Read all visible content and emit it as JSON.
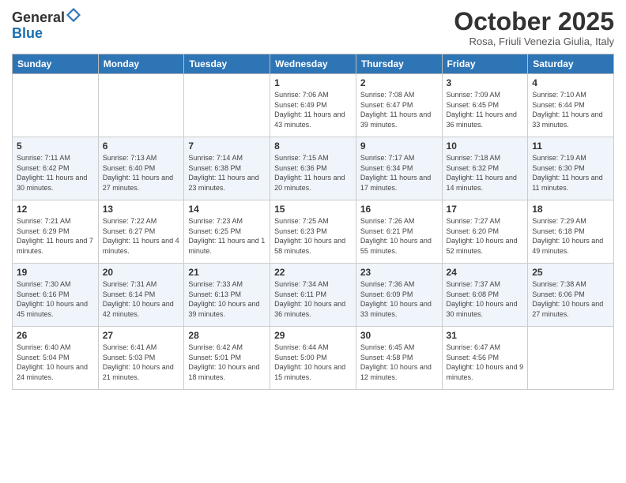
{
  "header": {
    "logo_general": "General",
    "logo_blue": "Blue",
    "month_title": "October 2025",
    "location": "Rosa, Friuli Venezia Giulia, Italy"
  },
  "weekdays": [
    "Sunday",
    "Monday",
    "Tuesday",
    "Wednesday",
    "Thursday",
    "Friday",
    "Saturday"
  ],
  "weeks": [
    [
      {
        "day": "",
        "sunrise": "",
        "sunset": "",
        "daylight": ""
      },
      {
        "day": "",
        "sunrise": "",
        "sunset": "",
        "daylight": ""
      },
      {
        "day": "",
        "sunrise": "",
        "sunset": "",
        "daylight": ""
      },
      {
        "day": "1",
        "sunrise": "Sunrise: 7:06 AM",
        "sunset": "Sunset: 6:49 PM",
        "daylight": "Daylight: 11 hours and 43 minutes."
      },
      {
        "day": "2",
        "sunrise": "Sunrise: 7:08 AM",
        "sunset": "Sunset: 6:47 PM",
        "daylight": "Daylight: 11 hours and 39 minutes."
      },
      {
        "day": "3",
        "sunrise": "Sunrise: 7:09 AM",
        "sunset": "Sunset: 6:45 PM",
        "daylight": "Daylight: 11 hours and 36 minutes."
      },
      {
        "day": "4",
        "sunrise": "Sunrise: 7:10 AM",
        "sunset": "Sunset: 6:44 PM",
        "daylight": "Daylight: 11 hours and 33 minutes."
      }
    ],
    [
      {
        "day": "5",
        "sunrise": "Sunrise: 7:11 AM",
        "sunset": "Sunset: 6:42 PM",
        "daylight": "Daylight: 11 hours and 30 minutes."
      },
      {
        "day": "6",
        "sunrise": "Sunrise: 7:13 AM",
        "sunset": "Sunset: 6:40 PM",
        "daylight": "Daylight: 11 hours and 27 minutes."
      },
      {
        "day": "7",
        "sunrise": "Sunrise: 7:14 AM",
        "sunset": "Sunset: 6:38 PM",
        "daylight": "Daylight: 11 hours and 23 minutes."
      },
      {
        "day": "8",
        "sunrise": "Sunrise: 7:15 AM",
        "sunset": "Sunset: 6:36 PM",
        "daylight": "Daylight: 11 hours and 20 minutes."
      },
      {
        "day": "9",
        "sunrise": "Sunrise: 7:17 AM",
        "sunset": "Sunset: 6:34 PM",
        "daylight": "Daylight: 11 hours and 17 minutes."
      },
      {
        "day": "10",
        "sunrise": "Sunrise: 7:18 AM",
        "sunset": "Sunset: 6:32 PM",
        "daylight": "Daylight: 11 hours and 14 minutes."
      },
      {
        "day": "11",
        "sunrise": "Sunrise: 7:19 AM",
        "sunset": "Sunset: 6:30 PM",
        "daylight": "Daylight: 11 hours and 11 minutes."
      }
    ],
    [
      {
        "day": "12",
        "sunrise": "Sunrise: 7:21 AM",
        "sunset": "Sunset: 6:29 PM",
        "daylight": "Daylight: 11 hours and 7 minutes."
      },
      {
        "day": "13",
        "sunrise": "Sunrise: 7:22 AM",
        "sunset": "Sunset: 6:27 PM",
        "daylight": "Daylight: 11 hours and 4 minutes."
      },
      {
        "day": "14",
        "sunrise": "Sunrise: 7:23 AM",
        "sunset": "Sunset: 6:25 PM",
        "daylight": "Daylight: 11 hours and 1 minute."
      },
      {
        "day": "15",
        "sunrise": "Sunrise: 7:25 AM",
        "sunset": "Sunset: 6:23 PM",
        "daylight": "Daylight: 10 hours and 58 minutes."
      },
      {
        "day": "16",
        "sunrise": "Sunrise: 7:26 AM",
        "sunset": "Sunset: 6:21 PM",
        "daylight": "Daylight: 10 hours and 55 minutes."
      },
      {
        "day": "17",
        "sunrise": "Sunrise: 7:27 AM",
        "sunset": "Sunset: 6:20 PM",
        "daylight": "Daylight: 10 hours and 52 minutes."
      },
      {
        "day": "18",
        "sunrise": "Sunrise: 7:29 AM",
        "sunset": "Sunset: 6:18 PM",
        "daylight": "Daylight: 10 hours and 49 minutes."
      }
    ],
    [
      {
        "day": "19",
        "sunrise": "Sunrise: 7:30 AM",
        "sunset": "Sunset: 6:16 PM",
        "daylight": "Daylight: 10 hours and 45 minutes."
      },
      {
        "day": "20",
        "sunrise": "Sunrise: 7:31 AM",
        "sunset": "Sunset: 6:14 PM",
        "daylight": "Daylight: 10 hours and 42 minutes."
      },
      {
        "day": "21",
        "sunrise": "Sunrise: 7:33 AM",
        "sunset": "Sunset: 6:13 PM",
        "daylight": "Daylight: 10 hours and 39 minutes."
      },
      {
        "day": "22",
        "sunrise": "Sunrise: 7:34 AM",
        "sunset": "Sunset: 6:11 PM",
        "daylight": "Daylight: 10 hours and 36 minutes."
      },
      {
        "day": "23",
        "sunrise": "Sunrise: 7:36 AM",
        "sunset": "Sunset: 6:09 PM",
        "daylight": "Daylight: 10 hours and 33 minutes."
      },
      {
        "day": "24",
        "sunrise": "Sunrise: 7:37 AM",
        "sunset": "Sunset: 6:08 PM",
        "daylight": "Daylight: 10 hours and 30 minutes."
      },
      {
        "day": "25",
        "sunrise": "Sunrise: 7:38 AM",
        "sunset": "Sunset: 6:06 PM",
        "daylight": "Daylight: 10 hours and 27 minutes."
      }
    ],
    [
      {
        "day": "26",
        "sunrise": "Sunrise: 6:40 AM",
        "sunset": "Sunset: 5:04 PM",
        "daylight": "Daylight: 10 hours and 24 minutes."
      },
      {
        "day": "27",
        "sunrise": "Sunrise: 6:41 AM",
        "sunset": "Sunset: 5:03 PM",
        "daylight": "Daylight: 10 hours and 21 minutes."
      },
      {
        "day": "28",
        "sunrise": "Sunrise: 6:42 AM",
        "sunset": "Sunset: 5:01 PM",
        "daylight": "Daylight: 10 hours and 18 minutes."
      },
      {
        "day": "29",
        "sunrise": "Sunrise: 6:44 AM",
        "sunset": "Sunset: 5:00 PM",
        "daylight": "Daylight: 10 hours and 15 minutes."
      },
      {
        "day": "30",
        "sunrise": "Sunrise: 6:45 AM",
        "sunset": "Sunset: 4:58 PM",
        "daylight": "Daylight: 10 hours and 12 minutes."
      },
      {
        "day": "31",
        "sunrise": "Sunrise: 6:47 AM",
        "sunset": "Sunset: 4:56 PM",
        "daylight": "Daylight: 10 hours and 9 minutes."
      },
      {
        "day": "",
        "sunrise": "",
        "sunset": "",
        "daylight": ""
      }
    ]
  ]
}
